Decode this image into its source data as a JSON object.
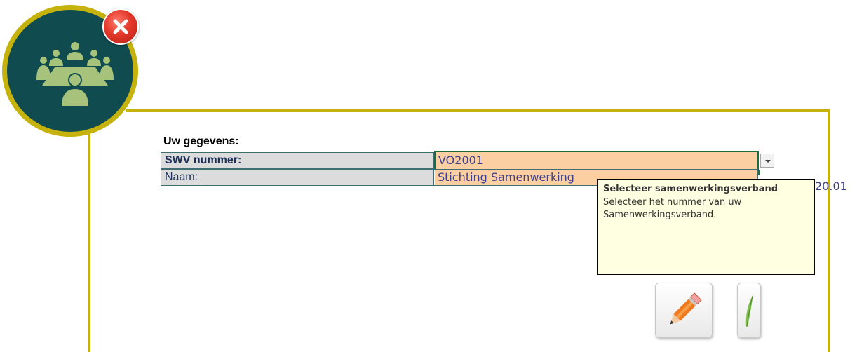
{
  "logo": {
    "icon": "meeting-group-icon"
  },
  "close": {
    "icon": "close-icon",
    "color": "#e4382a"
  },
  "form": {
    "heading": "Uw gegevens:",
    "rows": [
      {
        "label": "SWV nummer:",
        "value": "VO2001"
      },
      {
        "label": "Naam:",
        "value": "Stichting Samenwerking"
      }
    ],
    "overflow_text": "20.01"
  },
  "tooltip": {
    "title": "Selecteer samenwerkingsverband",
    "body_line1": "Selecteer het nummer van uw",
    "body_line2": "Samenwerkingsverband."
  },
  "buttons": [
    {
      "icon": "pencil-icon"
    },
    {
      "icon": "leaf-icon"
    }
  ],
  "colors": {
    "frame": "#c6b20c",
    "logo_bg": "#0f4b4f",
    "value_bg": "#fccfa3",
    "label_bg": "#dcdcdc",
    "tooltip_bg": "#ffffe1"
  }
}
